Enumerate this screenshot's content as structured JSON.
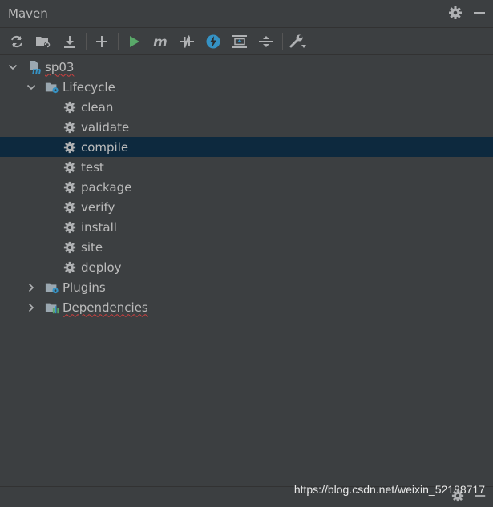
{
  "panel": {
    "title": "Maven"
  },
  "toolbar": {
    "icons": [
      "reload-icon",
      "generate-sources-icon",
      "download-icon",
      "add-icon",
      "run-icon",
      "maven-goal-icon",
      "toggle-offline-icon",
      "skip-tests-icon",
      "show-dependencies-icon",
      "collapse-all-icon",
      "settings-wrench-icon"
    ]
  },
  "tree": {
    "project": "sp03",
    "lifecycle": {
      "label": "Lifecycle",
      "goals": [
        "clean",
        "validate",
        "compile",
        "test",
        "package",
        "verify",
        "install",
        "site",
        "deploy"
      ],
      "selected": "compile"
    },
    "plugins": "Plugins",
    "dependencies": "Dependencies"
  },
  "watermark": "https://blog.csdn.net/weixin_52188717",
  "colors": {
    "background": "#3c3f41",
    "selection": "#0d293e",
    "run": "#59a869",
    "accent": "#3592c4"
  }
}
